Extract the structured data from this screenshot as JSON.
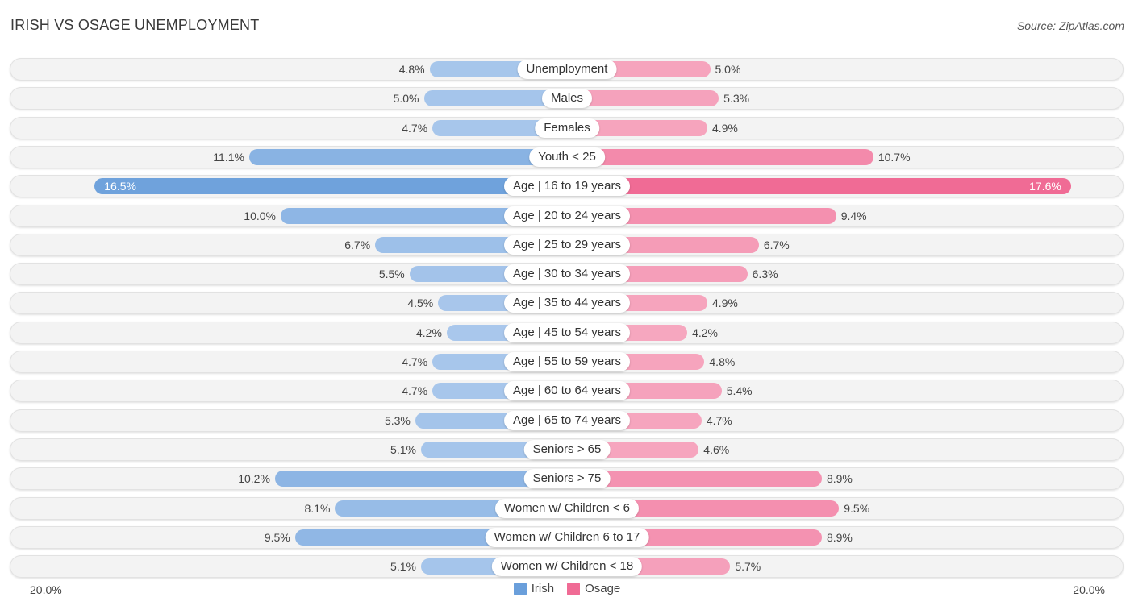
{
  "header": {
    "title": "IRISH VS OSAGE UNEMPLOYMENT",
    "source": "Source: ZipAtlas.com"
  },
  "colors": {
    "irish": "#6a9fdb",
    "osage": "#f06b95",
    "irish_light": "#aac8ec",
    "osage_light": "#f6a8c0"
  },
  "chart_data": {
    "type": "bar",
    "orientation": "horizontal-diverging",
    "title": "IRISH VS OSAGE UNEMPLOYMENT",
    "xlabel": "",
    "ylabel": "",
    "xlim": [
      -20,
      20
    ],
    "axis_tick_labels": [
      "20.0%",
      "20.0%"
    ],
    "legend_position": "bottom-center",
    "categories": [
      "Unemployment",
      "Males",
      "Females",
      "Youth < 25",
      "Age | 16 to 19 years",
      "Age | 20 to 24 years",
      "Age | 25 to 29 years",
      "Age | 30 to 34 years",
      "Age | 35 to 44 years",
      "Age | 45 to 54 years",
      "Age | 55 to 59 years",
      "Age | 60 to 64 years",
      "Age | 65 to 74 years",
      "Seniors > 65",
      "Seniors > 75",
      "Women w/ Children < 6",
      "Women w/ Children 6 to 17",
      "Women w/ Children < 18"
    ],
    "series": [
      {
        "name": "Irish",
        "side": "left",
        "values": [
          4.8,
          5.0,
          4.7,
          11.1,
          16.5,
          10.0,
          6.7,
          5.5,
          4.5,
          4.2,
          4.7,
          4.7,
          5.3,
          5.1,
          10.2,
          8.1,
          9.5,
          5.1
        ],
        "labels": [
          "4.8%",
          "5.0%",
          "4.7%",
          "11.1%",
          "16.5%",
          "10.0%",
          "6.7%",
          "5.5%",
          "4.5%",
          "4.2%",
          "4.7%",
          "4.7%",
          "5.3%",
          "5.1%",
          "10.2%",
          "8.1%",
          "9.5%",
          "5.1%"
        ]
      },
      {
        "name": "Osage",
        "side": "right",
        "values": [
          5.0,
          5.3,
          4.9,
          10.7,
          17.6,
          9.4,
          6.7,
          6.3,
          4.9,
          4.2,
          4.8,
          5.4,
          4.7,
          4.6,
          8.9,
          9.5,
          8.9,
          5.7
        ],
        "labels": [
          "5.0%",
          "5.3%",
          "4.9%",
          "10.7%",
          "17.6%",
          "9.4%",
          "6.7%",
          "6.3%",
          "4.9%",
          "4.2%",
          "4.8%",
          "5.4%",
          "4.7%",
          "4.6%",
          "8.9%",
          "9.5%",
          "8.9%",
          "5.7%"
        ]
      }
    ]
  },
  "legend": {
    "items": [
      {
        "label": "Irish"
      },
      {
        "label": "Osage"
      }
    ]
  },
  "axis": {
    "left_label": "20.0%",
    "right_label": "20.0%"
  }
}
